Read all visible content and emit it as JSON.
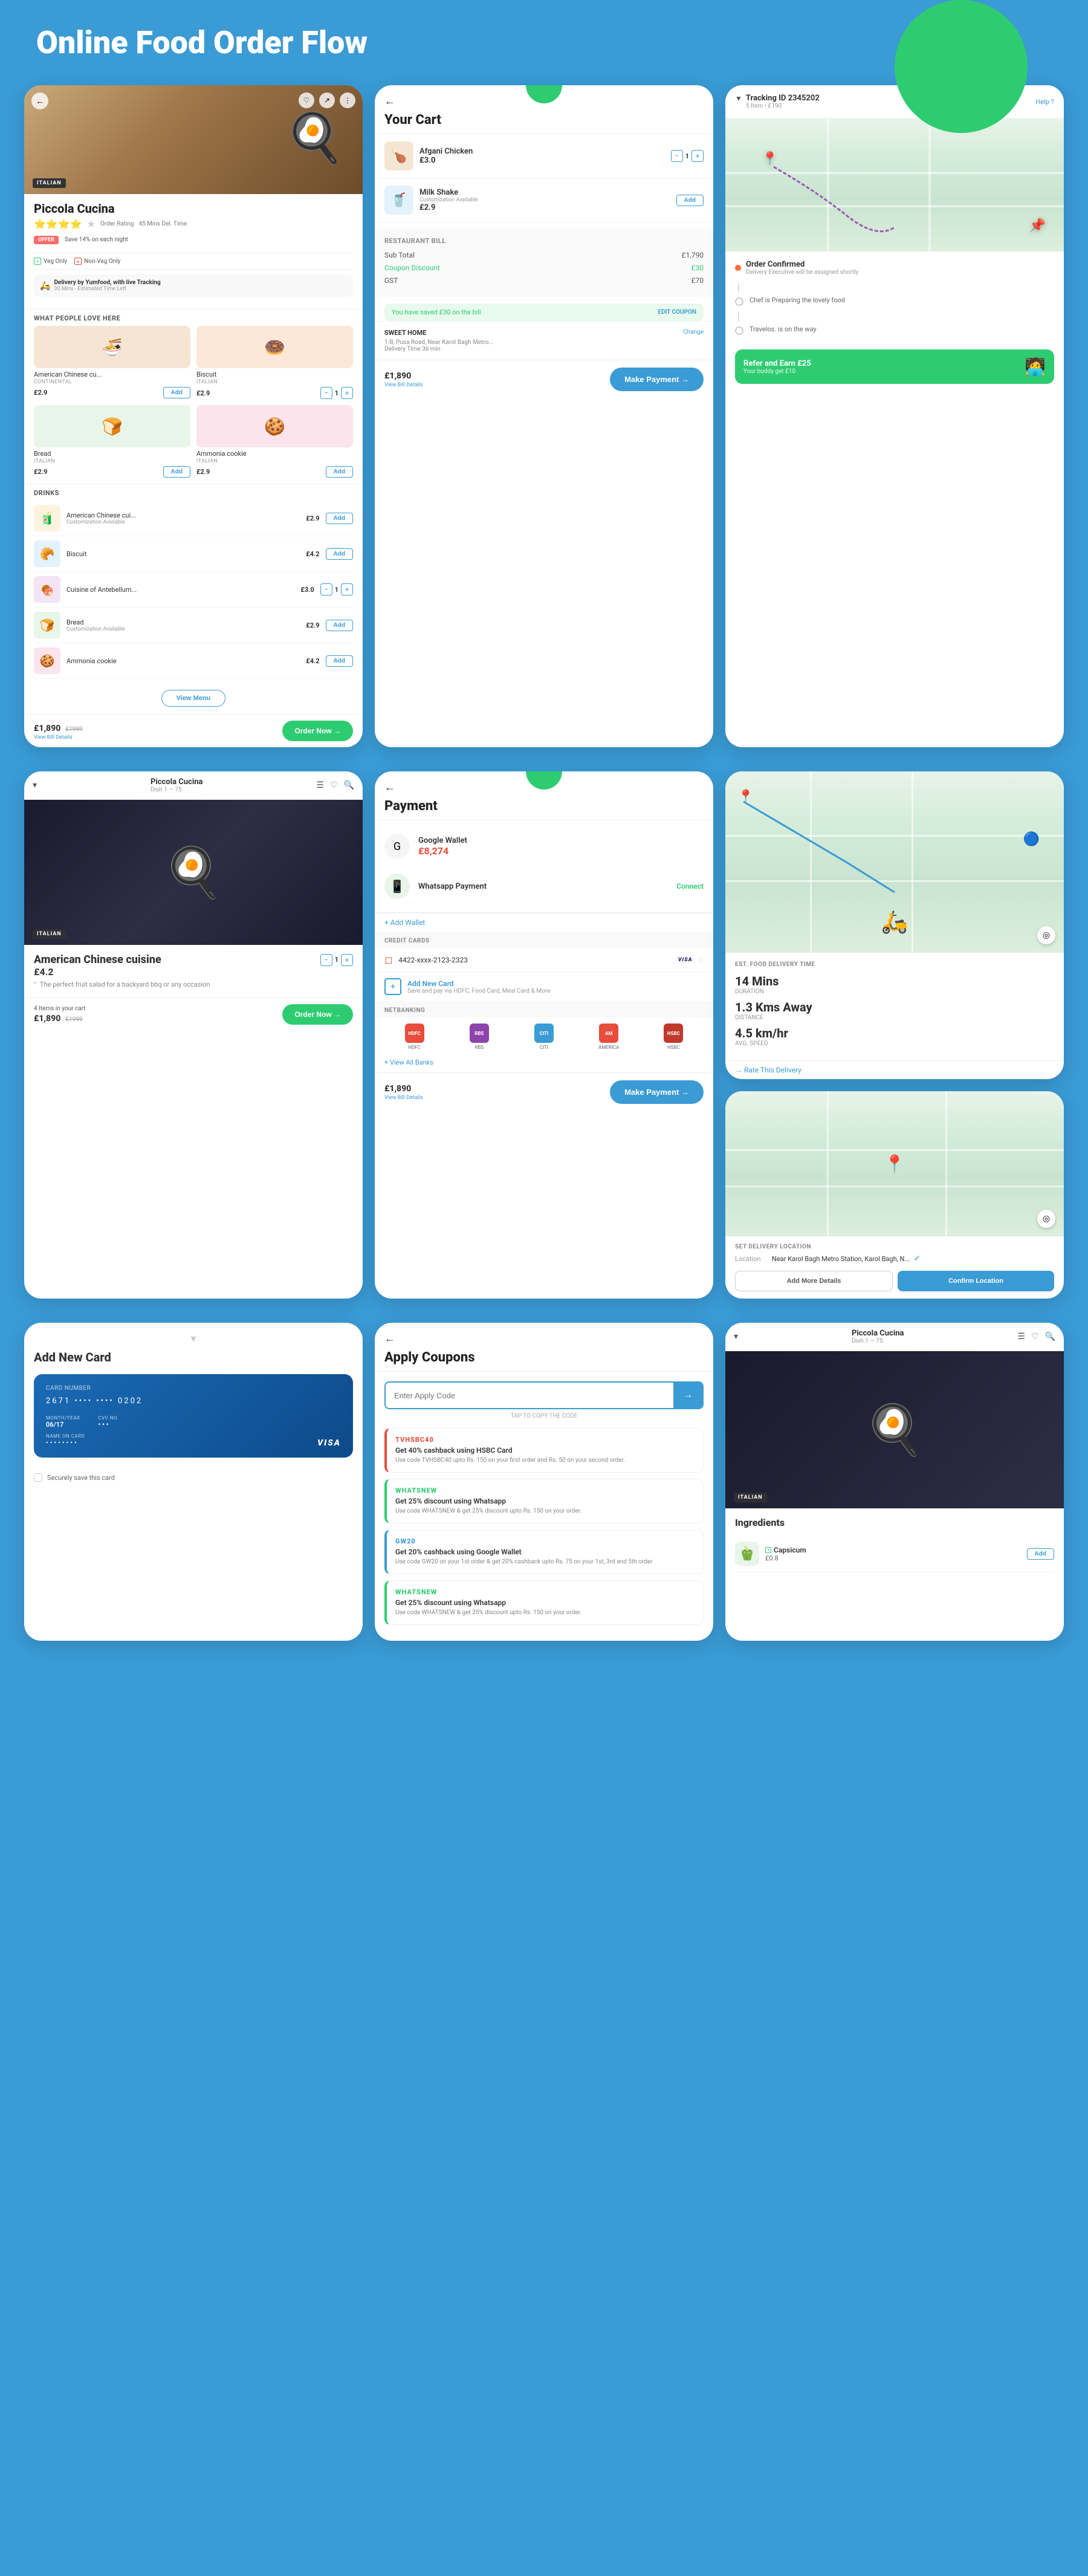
{
  "page": {
    "title": "Online Food Order Flow",
    "bg_color": "#3a9bd5"
  },
  "screen1": {
    "badge": "ITALIAN",
    "restaurant_name": "Piccola Cucina",
    "rating": "Order Rating",
    "delivery_time": "45 Mins Del. Time",
    "offer_badge": "OFFER",
    "offer_text": "Save 14% on each night",
    "veg_label": "Veg Only",
    "nonveg_label": "Non-Veg Only",
    "delivery_label": "Delivery by Yumfood, with live Tracking",
    "delivery_sub": "30 Mins - Estimated Time Left",
    "section_label": "WHAT PEOPLE LOVE HERE",
    "foods": [
      {
        "name": "American Chinese cu...",
        "sub": "CONTINENTAL",
        "price": "£2.9",
        "action": "Add"
      },
      {
        "name": "Biscuit",
        "sub": "ITALIAN",
        "price": "£2.9",
        "action": "qty"
      },
      {
        "name": "Bread",
        "sub": "ITALIAN",
        "price": "£2.9",
        "action": "Add"
      },
      {
        "name": "Ammonia cookie",
        "sub": "ITALIAN",
        "price": "£2.9",
        "action": "Add"
      }
    ],
    "drinks_label": "DRINKS",
    "drinks": [
      {
        "name": "American Chinese cui...",
        "sub": "Customization Available",
        "price": "£2.9"
      },
      {
        "name": "Biscuit",
        "sub": "",
        "price": "£4.2"
      },
      {
        "name": "Cuisine of Antebellum...",
        "sub": "",
        "price": "£3.0"
      },
      {
        "name": "Bread",
        "sub": "Customization Available",
        "price": "£2.9"
      },
      {
        "name": "Ammonia cookie",
        "sub": "",
        "price": "£4.2"
      }
    ],
    "view_menu": "View Menu",
    "cart_price": "£1,890",
    "cart_orig": "£1999",
    "cart_sub": "View Bill Details",
    "order_btn": "Order Now →"
  },
  "screen2": {
    "title": "Your Cart",
    "items": [
      {
        "name": "Afgani Chicken",
        "price": "£3.0",
        "qty": "1"
      },
      {
        "name": "Milk Shake",
        "price": "£2.9",
        "sub": "Customization Available",
        "action": "Add"
      }
    ],
    "bill_title": "RESTAURANT BILL",
    "sub_total_label": "Sub Total",
    "sub_total": "£1,790",
    "discount_label": "Coupon Discount",
    "discount": "£30",
    "gst_label": "GST",
    "gst": "£70",
    "savings_text": "You have saved £30 on the bill",
    "edit_coupon": "EDIT COUPON",
    "address_label": "SWEET HOME",
    "address_change": "Change",
    "address_text": "1-B, Pusa Road, Near Karol Bagh Metro...",
    "delivery_time_label": "Delivery Time 36 min",
    "total": "£1,890",
    "payment_btn": "Make Payment →",
    "view_bill": "View Bill Details"
  },
  "screen3": {
    "tracking_label": "Tracking ID 2345202",
    "items_count": "5 Item",
    "total": "£190",
    "help": "Help ?",
    "statuses": [
      {
        "label": "Order Confirmed",
        "sub": "Delivery Executive will be assigned shortly",
        "active": true
      },
      {
        "label": "Chef is Preparing the lovely food"
      },
      {
        "label": "Travelos. is on the way"
      }
    ],
    "refer_title": "Refer and Earn £25",
    "refer_sub": "Your buddy get £10"
  },
  "screen4": {
    "restaurant": "Piccola Cucina",
    "dish_range": "Dish 1 — 75",
    "badge": "ITALIAN",
    "dish_name": "American Chinese cuisine",
    "dish_price": "£4.2",
    "dish_desc": "The perfect fruit salad for a backyard bbq or any occasion",
    "items_in_cart": "4 Items in your cart",
    "cart_price": "£1,890",
    "cart_orig": "£1999",
    "order_btn": "Order Now →"
  },
  "screen5": {
    "title": "Payment",
    "google_wallet": "Google Wallet",
    "google_amount": "£8,274",
    "whatsapp": "Whatsapp Payment",
    "connect": "Connect",
    "add_wallet": "+ Add Wallet",
    "credit_cards_label": "CREDIT CARDS",
    "card_number": "4422-xxxx-2123-2323",
    "visa": "VISA",
    "add_card": "Add New Card",
    "add_card_sub": "Save and pay via HDFC, Food Card, Meal Card & More",
    "netbanking_label": "NETBANKING",
    "banks": [
      "HDFC",
      "RBS",
      "CITI",
      "AMERICA",
      "HSBC"
    ],
    "view_all": "+ View All Banks",
    "total": "£1,890",
    "payment_btn": "Make Payment →",
    "view_bill": "View Bill Details"
  },
  "screen6": {
    "est_label": "EST. FOOD DELIVERY TIME",
    "duration_val": "14 Mins",
    "duration_lbl": "Duration",
    "distance_val": "1.3 Kms Away",
    "distance_lbl": "Distance",
    "speed_val": "4.5 km/hr",
    "speed_lbl": "Avg. Speed",
    "rate": "→ Rate This Delivery"
  },
  "screen7": {
    "set_delivery_label": "SET DELIVERY LOCATION",
    "location_label": "Location",
    "location_text": "Near Karol Bagh Metro Station, Karol Bagh, N...",
    "add_details": "Add More Details",
    "confirm": "Confirm Location"
  },
  "screen8": {
    "title": "Apply Coupons",
    "input_placeholder": "Enter Apply Code",
    "tap_copy": "TAP TO COPY THE CODE",
    "coupons": [
      {
        "code": "TVHSBC40",
        "code_color": "#e74c3c",
        "title": "Get 40% cashback using HSBC Card",
        "desc": "Use code TVHSBC40 upto Rs. 150 on your first order and Rs. 50 on your second order."
      },
      {
        "code": "WHATSNEW",
        "code_color": "#2ecc71",
        "title": "Get 25% discount using Whatsapp",
        "desc": "Use code WHATSNEW & get 25% discount upto Rs. 150 on your order."
      },
      {
        "code": "GW20",
        "code_color": "#3a9bd5",
        "title": "Get 20% cashback using Google Wallet",
        "desc": "Use code GW20 on your 1st order & get 20% cashback upto Rs. 75 on your 1st, 3rd and 5th order"
      },
      {
        "code": "WHATSNEW",
        "code_color": "#2ecc71",
        "title": "Get 25% discount using Whatsapp",
        "desc": "Use code WHATSNEW & get 25% discount upto Rs. 150 on your order."
      }
    ]
  },
  "screen9": {
    "title": "Add New Card",
    "card_number": "2671  ••••  ••••  0202",
    "month_year_label": "MONTH/YEAR",
    "month_year": "06/17",
    "cvv_label": "CVV NO.",
    "cvv": "",
    "name_label": "NAME ON CARD",
    "name": "••••••••",
    "save_label": "Securely save this card"
  },
  "screen10": {
    "restaurant": "Piccola Cucina",
    "dish_range": "Dish 1 — 75",
    "badge": "ITALIAN",
    "section": "Ingredients",
    "items": [
      {
        "name": "Capsicum",
        "price": "£0.8",
        "action": "Add"
      }
    ]
  }
}
